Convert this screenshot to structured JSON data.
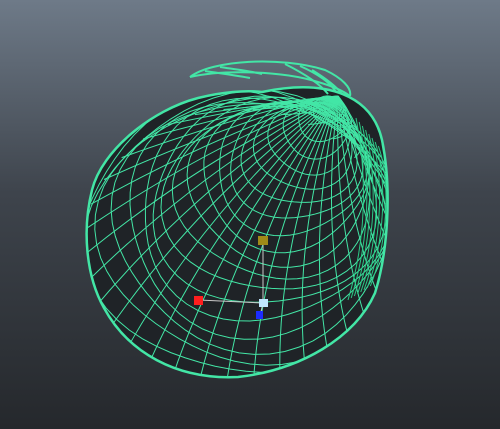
{
  "viewport": {
    "background_top": "#6e7a88",
    "background_bottom": "#25282c"
  },
  "mesh": {
    "object": "wireframe-teardrop-mesh",
    "wire_color": "#43e6a6",
    "edge_color": "#2cc986"
  },
  "manipulator": {
    "pivot_color": "#bfe7ff",
    "x_handle_color": "#ff1e1e",
    "y_handle_color": "#a08a18",
    "z_handle_color": "#1c2cff"
  }
}
